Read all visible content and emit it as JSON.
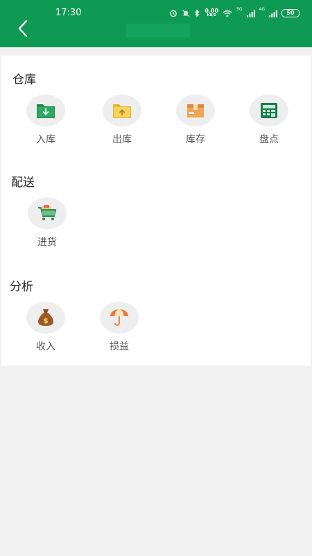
{
  "status_bar": {
    "time": "17:30",
    "net_speed": "0.00",
    "net_speed_unit": "KB/S",
    "signal_label_1": "5G",
    "signal_label_2": "4G",
    "battery": "50"
  },
  "colors": {
    "brand": "#0e9a52",
    "icon_bg": "#eeeeee",
    "page_bg": "#f1f1f1"
  },
  "sections": {
    "warehouse": {
      "title": "仓库",
      "items": [
        {
          "label": "入库",
          "icon": "folder-download-icon"
        },
        {
          "label": "出库",
          "icon": "folder-upload-icon"
        },
        {
          "label": "库存",
          "icon": "package-box-icon"
        },
        {
          "label": "盘点",
          "icon": "calculator-icon"
        }
      ]
    },
    "delivery": {
      "title": "配送",
      "items": [
        {
          "label": "进货",
          "icon": "shopping-cart-icon"
        }
      ]
    },
    "analysis": {
      "title": "分析",
      "items": [
        {
          "label": "收入",
          "icon": "money-bag-icon"
        },
        {
          "label": "损益",
          "icon": "umbrella-icon"
        }
      ]
    }
  }
}
